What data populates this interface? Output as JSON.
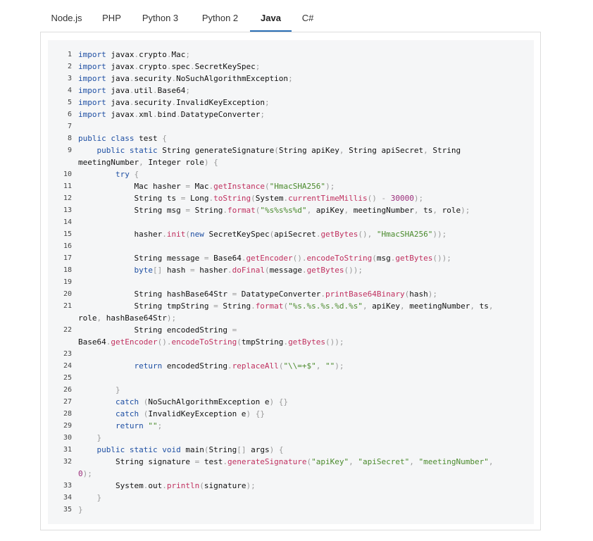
{
  "tabs": [
    {
      "label": "Node.js",
      "active": false
    },
    {
      "label": "PHP",
      "active": false
    },
    {
      "label": "Python 3",
      "active": false
    },
    {
      "label": "Python 2",
      "active": false
    },
    {
      "label": "Java",
      "active": true
    },
    {
      "label": "C#",
      "active": false
    }
  ],
  "code": {
    "language": "Java",
    "lines": [
      "import javax.crypto.Mac;",
      "import javax.crypto.spec.SecretKeySpec;",
      "import java.security.NoSuchAlgorithmException;",
      "import java.util.Base64;",
      "import java.security.InvalidKeyException;",
      "import javax.xml.bind.DatatypeConverter;",
      "",
      "public class test {",
      "    public static String generateSignature(String apiKey, String apiSecret, String meetingNumber, Integer role) {",
      "        try {",
      "            Mac hasher = Mac.getInstance(\"HmacSHA256\");",
      "            String ts = Long.toString(System.currentTimeMillis() - 30000);",
      "            String msg = String.format(\"%s%s%s%d\", apiKey, meetingNumber, ts, role);",
      "",
      "            hasher.init(new SecretKeySpec(apiSecret.getBytes(), \"HmacSHA256\"));",
      "",
      "            String message = Base64.getEncoder().encodeToString(msg.getBytes());",
      "            byte[] hash = hasher.doFinal(message.getBytes());",
      "",
      "            String hashBase64Str = DatatypeConverter.printBase64Binary(hash);",
      "            String tmpString = String.format(\"%s.%s.%s.%d.%s\", apiKey, meetingNumber, ts, role, hashBase64Str);",
      "            String encodedString = Base64.getEncoder().encodeToString(tmpString.getBytes());",
      "",
      "            return encodedString.replaceAll(\"\\\\=+$\", \"\");",
      "",
      "        }",
      "        catch (NoSuchAlgorithmException e) {}",
      "        catch (InvalidKeyException e) {}",
      "        return \"\";",
      "    }",
      "    public static void main(String[] args) {",
      "        String signature = test.generateSignature(\"apiKey\", \"apiSecret\", \"meetingNumber\", 0);",
      "        System.out.println(signature);",
      "    }",
      "}"
    ]
  }
}
